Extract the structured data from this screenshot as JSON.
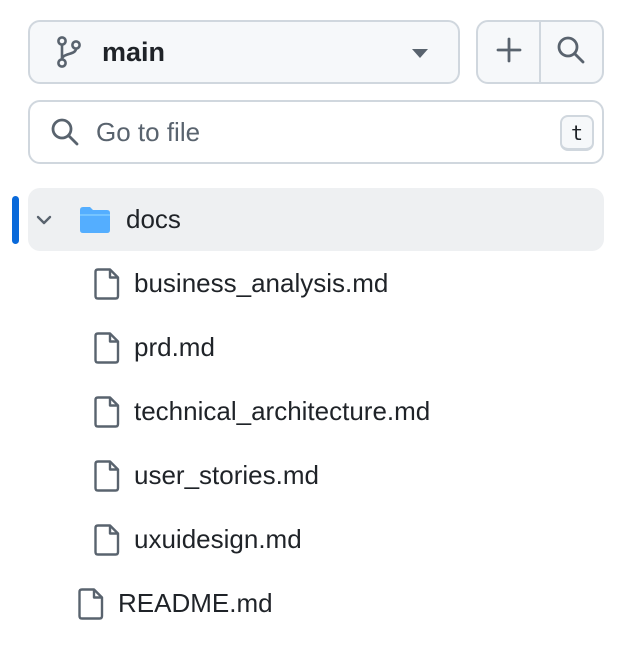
{
  "branch": {
    "name": "main"
  },
  "search": {
    "placeholder": "Go to file",
    "shortcut": "t"
  },
  "tree": {
    "folder": {
      "name": "docs",
      "expanded": true,
      "files": [
        "business_analysis.md",
        "prd.md",
        "technical_architecture.md",
        "user_stories.md",
        "uxuidesign.md"
      ]
    },
    "root_files": [
      "README.md"
    ]
  },
  "colors": {
    "accent": "#0969da",
    "folder": "#54aeff",
    "selected_bg": "#eef0f2",
    "border": "#d0d7de",
    "muted_icon": "#59636e"
  }
}
